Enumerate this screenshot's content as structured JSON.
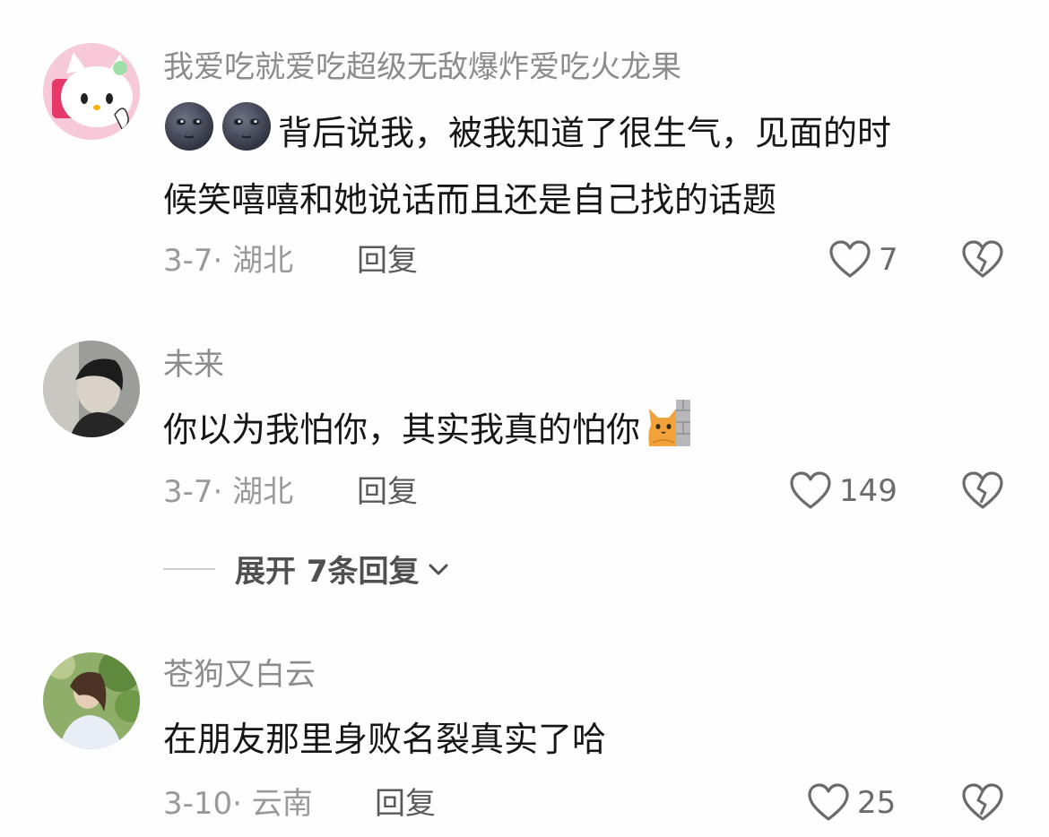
{
  "comments": [
    {
      "username": "我爱吃就爱吃超级无敌爆炸爱吃火龙果",
      "text_line1": "背后说我，被我知道了很生气，见面的时",
      "text_line2": "候笑嘻嘻和她说话而且还是自己找的话题",
      "date_location": "3-7· 湖北",
      "reply_label": "回复",
      "likes": "7"
    },
    {
      "username": "未来",
      "text": "你以为我怕你，其实我真的怕你",
      "date_location": "3-7· 湖北",
      "reply_label": "回复",
      "likes": "149",
      "expand_label": "展开 7条回复"
    },
    {
      "username": "苍狗又白云",
      "text": "在朋友那里身败名裂真实了哈",
      "date_location": "3-10· 云南",
      "reply_label": "回复",
      "likes": "25"
    }
  ],
  "icons": {
    "like": "heart-outline-icon",
    "dislike": "broken-heart-icon",
    "expand": "chevron-down-icon"
  }
}
